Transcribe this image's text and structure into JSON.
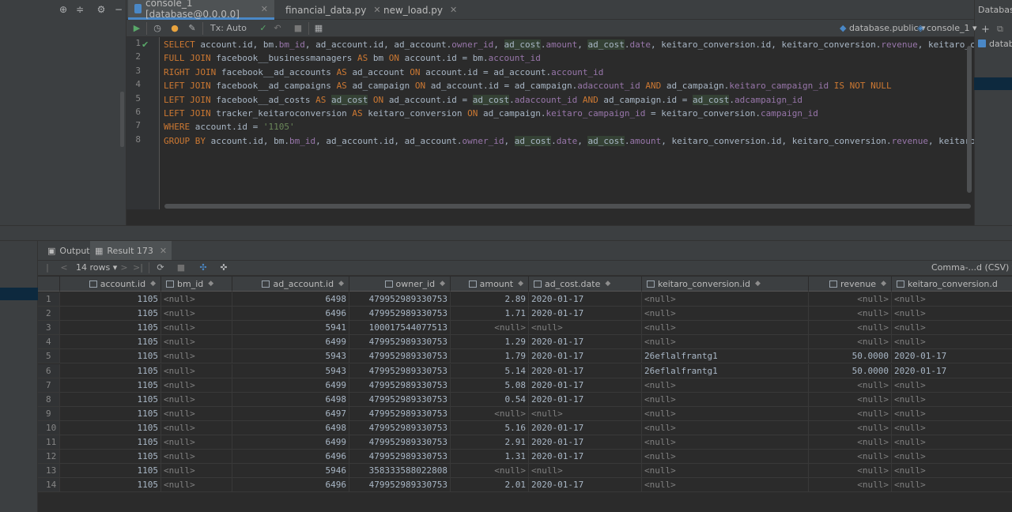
{
  "left_toolbar": {
    "icons": [
      "globe-icon",
      "collapse-icon",
      "gear-icon",
      "minimize-icon"
    ]
  },
  "tabs": [
    {
      "label": "console_1 [database@0.0.0.0]",
      "active": true
    },
    {
      "label": "financial_data.py",
      "active": false
    },
    {
      "label": "new_load.py",
      "active": false
    }
  ],
  "right_panel": {
    "header": "Databas",
    "item": "datab"
  },
  "toolbar": {
    "tx_label": "Tx: Auto",
    "schema": "database.public",
    "console": "console_1"
  },
  "editor": {
    "line_numbers": [
      "1",
      "2",
      "3",
      "4",
      "5",
      "6",
      "7",
      "8"
    ],
    "lines": [
      [
        [
          "kw",
          "SELECT "
        ],
        [
          "",
          "account."
        ],
        [
          "",
          "id, bm."
        ],
        [
          "fld",
          "bm_id"
        ],
        [
          "",
          ", ad_account."
        ],
        [
          "",
          "id, ad_account."
        ],
        [
          "fld",
          "owner_id"
        ],
        [
          "",
          ", "
        ],
        [
          "hl",
          "ad_cost"
        ],
        [
          "",
          "."
        ],
        [
          "fld",
          "amount"
        ],
        [
          "",
          ", "
        ],
        [
          "hl",
          "ad_cost"
        ],
        [
          "",
          "."
        ],
        [
          "fld",
          "date"
        ],
        [
          "",
          ", keitaro_conversion."
        ],
        [
          "",
          "id, keitaro_conversion."
        ],
        [
          "fld",
          "revenue"
        ],
        [
          "",
          ", keitaro_c"
        ]
      ],
      [
        [
          "kw",
          "FULL JOIN "
        ],
        [
          "",
          "facebook__businessmanagers "
        ],
        [
          "kw",
          "AS "
        ],
        [
          "",
          "bm "
        ],
        [
          "kw",
          "ON "
        ],
        [
          "",
          "account.id = bm."
        ],
        [
          "fld",
          "account_id"
        ]
      ],
      [
        [
          "kw",
          "RIGHT JOIN "
        ],
        [
          "",
          "facebook__ad_accounts "
        ],
        [
          "kw",
          "AS "
        ],
        [
          "",
          "ad_account "
        ],
        [
          "kw",
          "ON "
        ],
        [
          "",
          "account.id = ad_account."
        ],
        [
          "fld",
          "account_id"
        ]
      ],
      [
        [
          "kw",
          "LEFT JOIN "
        ],
        [
          "",
          "facebook__ad_campaigns "
        ],
        [
          "kw",
          "AS "
        ],
        [
          "",
          "ad_campaign "
        ],
        [
          "kw",
          "ON "
        ],
        [
          "",
          "ad_account.id = ad_campaign."
        ],
        [
          "fld",
          "adaccount_id"
        ],
        [
          "kw",
          " AND "
        ],
        [
          "",
          "ad_campaign."
        ],
        [
          "fld",
          "keitaro_campaign_id"
        ],
        [
          "kw",
          " IS NOT NULL"
        ]
      ],
      [
        [
          "kw",
          "LEFT JOIN "
        ],
        [
          "",
          "facebook__ad_costs "
        ],
        [
          "kw",
          "AS "
        ],
        [
          "hl",
          "ad_cost"
        ],
        [
          "kw",
          " ON "
        ],
        [
          "",
          "ad_account.id = "
        ],
        [
          "hl",
          "ad_cost"
        ],
        [
          "",
          "."
        ],
        [
          "fld",
          "adaccount_id"
        ],
        [
          "kw",
          " AND "
        ],
        [
          "",
          "ad_campaign.id = "
        ],
        [
          "hl",
          "ad_cost"
        ],
        [
          "",
          "."
        ],
        [
          "fld",
          "adcampaign_id"
        ]
      ],
      [
        [
          "kw",
          "LEFT JOIN "
        ],
        [
          "",
          "tracker_keitaroconversion "
        ],
        [
          "kw",
          "AS "
        ],
        [
          "",
          "keitaro_conversion "
        ],
        [
          "kw",
          "ON "
        ],
        [
          "",
          "ad_campaign."
        ],
        [
          "fld",
          "keitaro_campaign_id"
        ],
        [
          "",
          " = keitaro_conversion."
        ],
        [
          "fld",
          "campaign_id"
        ]
      ],
      [
        [
          "kw",
          "WHERE "
        ],
        [
          "",
          "account.id = "
        ],
        [
          "str",
          "'1105'"
        ]
      ],
      [
        [
          "kw",
          "GROUP BY "
        ],
        [
          "",
          "account.id, bm."
        ],
        [
          "fld",
          "bm_id"
        ],
        [
          "",
          ", ad_account.id, ad_account."
        ],
        [
          "fld",
          "owner_id"
        ],
        [
          "",
          ", "
        ],
        [
          "hl",
          "ad_cost"
        ],
        [
          "",
          "."
        ],
        [
          "fld",
          "date"
        ],
        [
          "",
          ", "
        ],
        [
          "hl",
          "ad_cost"
        ],
        [
          "",
          "."
        ],
        [
          "fld",
          "amount"
        ],
        [
          "",
          ", keitaro_conversion.id, keitaro_conversion."
        ],
        [
          "fld",
          "revenue"
        ],
        [
          "",
          ", keitaro"
        ]
      ]
    ]
  },
  "result_tabs": [
    {
      "label": "Output",
      "active": false
    },
    {
      "label": "Result 173",
      "active": true
    }
  ],
  "result_toolbar": {
    "rows_label": "14 rows",
    "export_format": "Comma-...d (CSV)"
  },
  "table": {
    "headers": [
      "account.id",
      "bm_id",
      "ad_account.id",
      "owner_id",
      "amount",
      "ad_cost.date",
      "keitaro_conversion.id",
      "revenue",
      "keitaro_conversion.d"
    ],
    "rows": [
      [
        "1",
        "1105",
        "<null>",
        "6498",
        "479952989330753",
        "2.89",
        "2020-01-17",
        "<null>",
        "<null>",
        "<null>"
      ],
      [
        "2",
        "1105",
        "<null>",
        "6496",
        "479952989330753",
        "1.71",
        "2020-01-17",
        "<null>",
        "<null>",
        "<null>"
      ],
      [
        "3",
        "1105",
        "<null>",
        "5941",
        "100017544077513",
        "<null>",
        "<null>",
        "<null>",
        "<null>",
        "<null>"
      ],
      [
        "4",
        "1105",
        "<null>",
        "6499",
        "479952989330753",
        "1.29",
        "2020-01-17",
        "<null>",
        "<null>",
        "<null>"
      ],
      [
        "5",
        "1105",
        "<null>",
        "5943",
        "479952989330753",
        "1.79",
        "2020-01-17",
        "26eflalfrantg1",
        "50.0000",
        "2020-01-17"
      ],
      [
        "6",
        "1105",
        "<null>",
        "5943",
        "479952989330753",
        "5.14",
        "2020-01-17",
        "26eflalfrantg1",
        "50.0000",
        "2020-01-17"
      ],
      [
        "7",
        "1105",
        "<null>",
        "6499",
        "479952989330753",
        "5.08",
        "2020-01-17",
        "<null>",
        "<null>",
        "<null>"
      ],
      [
        "8",
        "1105",
        "<null>",
        "6498",
        "479952989330753",
        "0.54",
        "2020-01-17",
        "<null>",
        "<null>",
        "<null>"
      ],
      [
        "9",
        "1105",
        "<null>",
        "6497",
        "479952989330753",
        "<null>",
        "<null>",
        "<null>",
        "<null>",
        "<null>"
      ],
      [
        "10",
        "1105",
        "<null>",
        "6498",
        "479952989330753",
        "5.16",
        "2020-01-17",
        "<null>",
        "<null>",
        "<null>"
      ],
      [
        "11",
        "1105",
        "<null>",
        "6499",
        "479952989330753",
        "2.91",
        "2020-01-17",
        "<null>",
        "<null>",
        "<null>"
      ],
      [
        "12",
        "1105",
        "<null>",
        "6496",
        "479952989330753",
        "1.31",
        "2020-01-17",
        "<null>",
        "<null>",
        "<null>"
      ],
      [
        "13",
        "1105",
        "<null>",
        "5946",
        "358333588022808",
        "<null>",
        "<null>",
        "<null>",
        "<null>",
        "<null>"
      ],
      [
        "14",
        "1105",
        "<null>",
        "6496",
        "479952989330753",
        "2.01",
        "2020-01-17",
        "<null>",
        "<null>",
        "<null>"
      ]
    ]
  }
}
